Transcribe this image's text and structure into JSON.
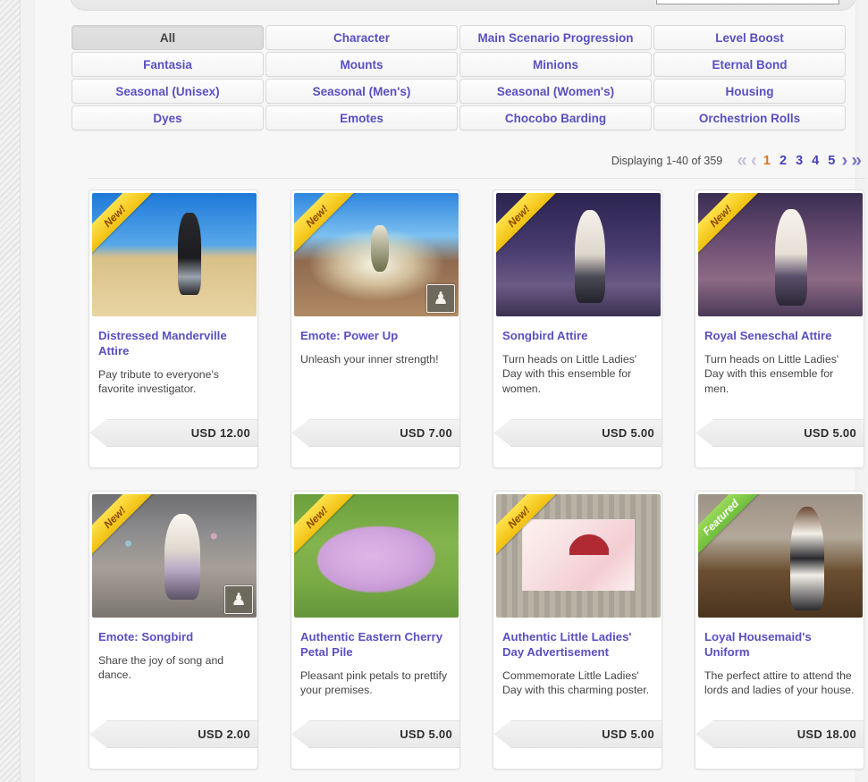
{
  "search": {
    "input_value": "",
    "placeholder": ""
  },
  "categories": [
    {
      "label": "All",
      "active": true
    },
    {
      "label": "Character",
      "active": false
    },
    {
      "label": "Main Scenario Progression",
      "active": false
    },
    {
      "label": "Level Boost",
      "active": false
    },
    {
      "label": "Fantasia",
      "active": false
    },
    {
      "label": "Mounts",
      "active": false
    },
    {
      "label": "Minions",
      "active": false
    },
    {
      "label": "Eternal Bond",
      "active": false
    },
    {
      "label": "Seasonal (Unisex)",
      "active": false
    },
    {
      "label": "Seasonal (Men's)",
      "active": false
    },
    {
      "label": "Seasonal (Women's)",
      "active": false
    },
    {
      "label": "Housing",
      "active": false
    },
    {
      "label": "Dyes",
      "active": false
    },
    {
      "label": "Emotes",
      "active": false
    },
    {
      "label": "Chocobo Barding",
      "active": false
    },
    {
      "label": "Orchestrion Rolls",
      "active": false
    }
  ],
  "pagination": {
    "displaying": "Displaying 1-40 of 359",
    "first_icon": "«",
    "prev_icon": "‹",
    "next_icon": "›",
    "last_icon": "»",
    "pages": [
      "1",
      "2",
      "3",
      "4",
      "5"
    ],
    "current_page": "1",
    "current_color": "#e0711a",
    "link_color": "#4a40b8",
    "disabled_color": "#c5c5d8"
  },
  "products": [
    {
      "title": "Distressed Manderville Attire",
      "description": "Pay tribute to everyone's favorite investigator.",
      "price": "USD 12.00",
      "badge": "New!",
      "badge_type": "new",
      "type_icon": "",
      "art": "art-desert"
    },
    {
      "title": "Emote: Power Up",
      "description": "Unleash your inner strength!",
      "price": "USD 7.00",
      "badge": "New!",
      "badge_type": "new",
      "type_icon": "emote-icon",
      "art": "art-burst"
    },
    {
      "title": "Songbird Attire",
      "description": "Turn heads on Little Ladies' Day with this ensemble for women.",
      "price": "USD 5.00",
      "badge": "New!",
      "badge_type": "new",
      "type_icon": "",
      "art": "art-night"
    },
    {
      "title": "Royal Seneschal Attire",
      "description": "Turn heads on Little Ladies' Day with this ensemble for men.",
      "price": "USD 5.00",
      "badge": "New!",
      "badge_type": "new",
      "type_icon": "",
      "art": "art-sakura"
    },
    {
      "title": "Emote:  Songbird",
      "description": "Share the joy of song and dance.",
      "price": "USD 2.00",
      "badge": "New!",
      "badge_type": "new",
      "type_icon": "emote-icon",
      "art": "art-stone"
    },
    {
      "title": "Authentic Eastern Cherry Petal Pile",
      "description": "Pleasant pink petals to prettify your premises.",
      "price": "USD 5.00",
      "badge": "New!",
      "badge_type": "new",
      "type_icon": "",
      "art": "art-grass"
    },
    {
      "title": "Authentic Little Ladies' Day Advertisement",
      "description": "Commemorate Little Ladies' Day with this charming poster.",
      "price": "USD 5.00",
      "badge": "New!",
      "badge_type": "new",
      "type_icon": "",
      "art": "art-wall"
    },
    {
      "title": "Loyal Housemaid's Uniform",
      "description": "The perfect attire to attend the lords and ladies of your house.",
      "price": "USD 18.00",
      "badge": "Featured",
      "badge_type": "featured",
      "type_icon": "",
      "art": "art-interior"
    }
  ]
}
